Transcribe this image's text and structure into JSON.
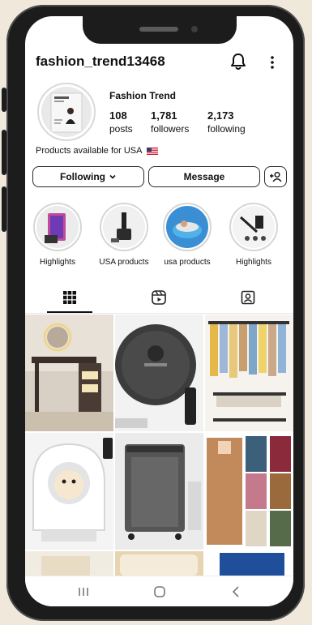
{
  "profile": {
    "username": "fashion_trend13468",
    "display_name": "Fashion Trend",
    "bio": "Products available for USA",
    "flag_icon": "us-flag-icon"
  },
  "stats": [
    {
      "value": "108",
      "label": "posts"
    },
    {
      "value": "1,781",
      "label": "followers"
    },
    {
      "value": "2,173",
      "label": "following"
    }
  ],
  "actions": {
    "following_label": "Following",
    "message_label": "Message"
  },
  "highlights": [
    {
      "label": "Highlights"
    },
    {
      "label": "USA products"
    },
    {
      "label": "usa products"
    },
    {
      "label": "Highlights"
    }
  ],
  "tabs": [
    {
      "icon": "grid-icon",
      "active": true
    },
    {
      "icon": "reels-icon",
      "active": false
    },
    {
      "icon": "tagged-icon",
      "active": false
    }
  ],
  "posts": [
    {
      "subject": "vanity desk with mirror"
    },
    {
      "subject": "robot vacuum"
    },
    {
      "subject": "clothing rack"
    },
    {
      "subject": "self-cleaning litter box"
    },
    {
      "subject": "laundry hamper"
    },
    {
      "subject": "cardigans collage"
    }
  ],
  "colors": {
    "background": "#efe8db",
    "phone_body": "#1c1c1c",
    "text": "#111111"
  }
}
